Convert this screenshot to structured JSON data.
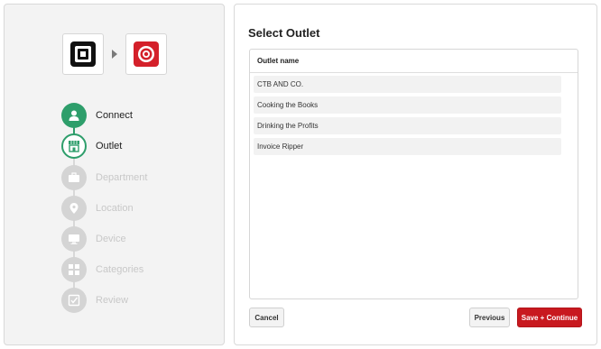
{
  "wizard": {
    "logos": {
      "source": "square-logo-icon",
      "target": "target-logo-icon"
    },
    "steps": [
      {
        "label": "Connect",
        "state": "done",
        "icon": "user-icon"
      },
      {
        "label": "Outlet",
        "state": "current",
        "icon": "store-icon"
      },
      {
        "label": "Department",
        "state": "future",
        "icon": "briefcase-icon"
      },
      {
        "label": "Location",
        "state": "future",
        "icon": "map-pin-icon"
      },
      {
        "label": "Device",
        "state": "future",
        "icon": "monitor-icon"
      },
      {
        "label": "Categories",
        "state": "future",
        "icon": "grid-icon"
      },
      {
        "label": "Review",
        "state": "future",
        "icon": "checkbox-icon"
      }
    ]
  },
  "main": {
    "title": "Select Outlet",
    "table": {
      "header": "Outlet name",
      "rows": [
        "CTB AND CO.",
        "Cooking the Books",
        "Drinking the Profits",
        "Invoice Ripper"
      ]
    }
  },
  "actions": {
    "cancel": "Cancel",
    "previous": "Previous",
    "continue": "Save + Continue"
  },
  "colors": {
    "accent_green": "#2e9e6b",
    "primary_red": "#c8191f"
  }
}
